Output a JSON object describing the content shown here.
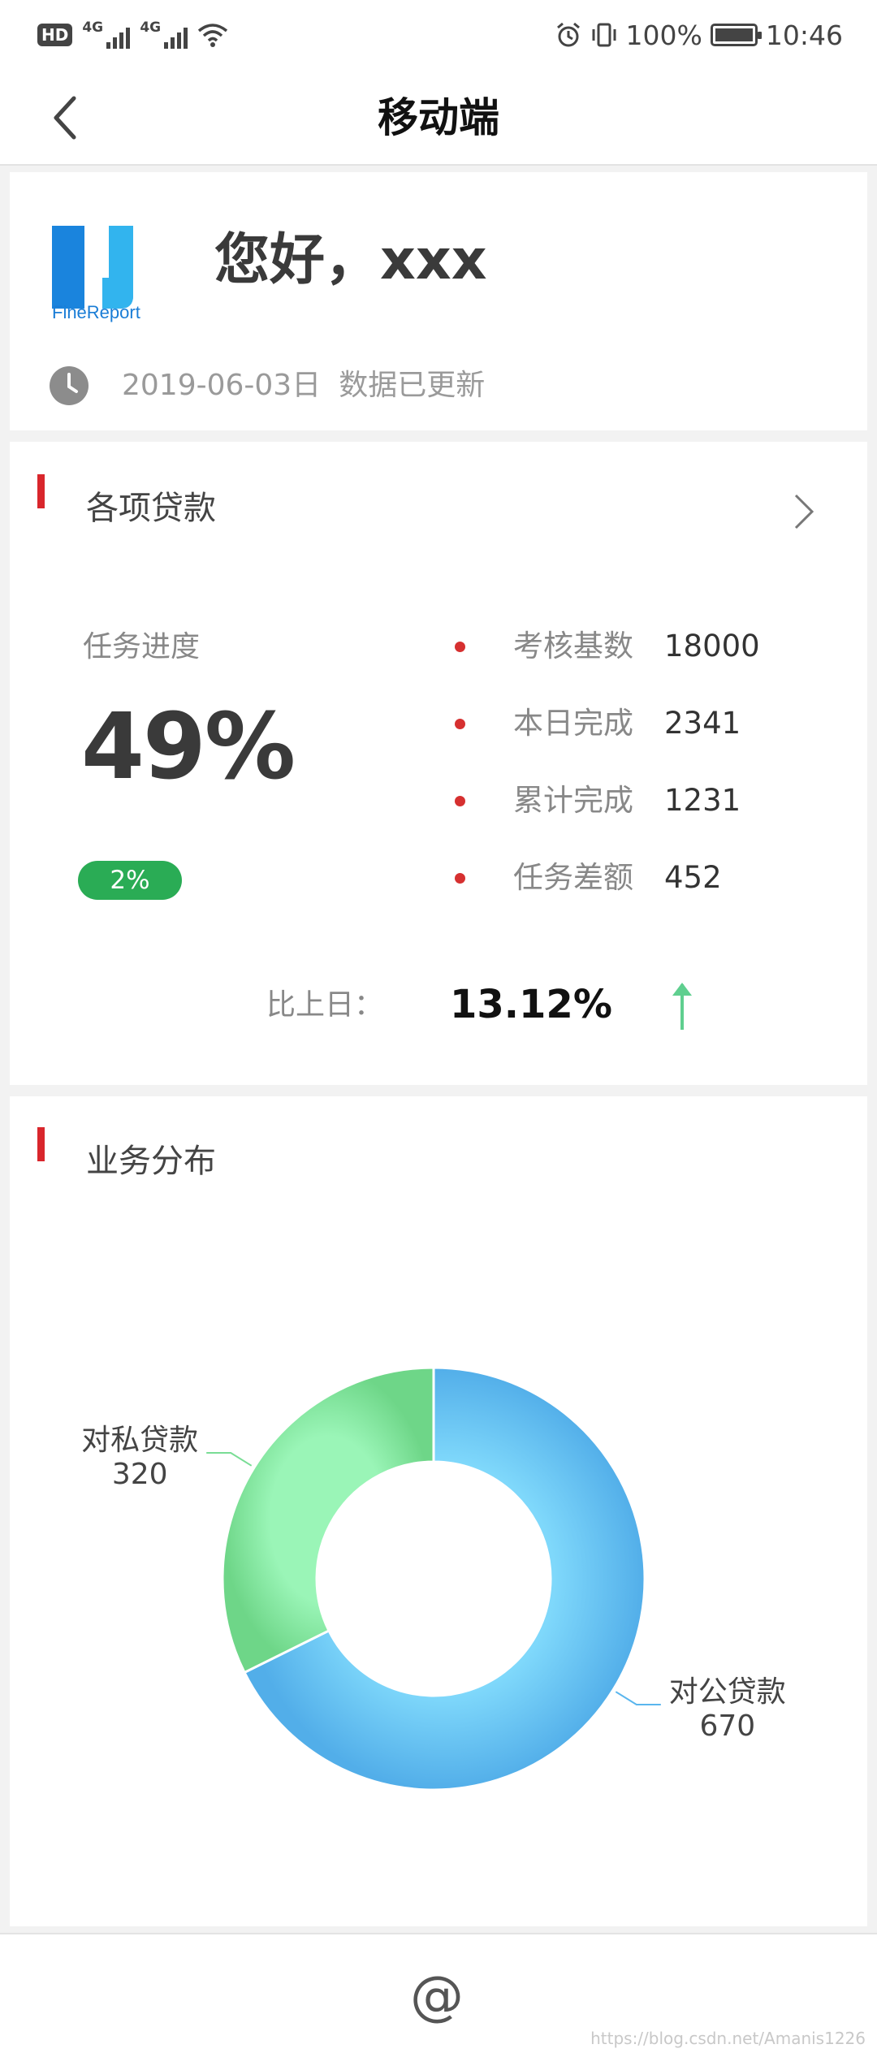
{
  "status_bar": {
    "hd": "HD",
    "network_1": "4G",
    "network_2": "4G",
    "battery": "100%",
    "time": "10:46"
  },
  "nav": {
    "title": "移动端"
  },
  "greeting_card": {
    "logo_text": "FineReport",
    "greeting": "您好，xxx",
    "date": "2019-06-03日",
    "update_text": "数据已更新"
  },
  "loan_card": {
    "title": "各项贷款",
    "progress_label": "任务进度",
    "progress_value": "49%",
    "delta_badge": "2%",
    "stats": [
      {
        "label": "考核基数",
        "value": "18000"
      },
      {
        "label": "本日完成",
        "value": "2341"
      },
      {
        "label": "累计完成",
        "value": "1231"
      },
      {
        "label": "任务差额",
        "value": "452"
      }
    ],
    "compare_label": "比上日：",
    "compare_value": "13.12%"
  },
  "distribution_card": {
    "title": "业务分布"
  },
  "chart_data": {
    "type": "pie",
    "categories": [
      "对公贷款",
      "对私贷款"
    ],
    "values": [
      670,
      320
    ],
    "colors": [
      "#5ab6ee",
      "#79dd95"
    ]
  },
  "footer": {
    "icon": "@"
  },
  "watermark": "https://blog.csdn.net/Amanis1226"
}
